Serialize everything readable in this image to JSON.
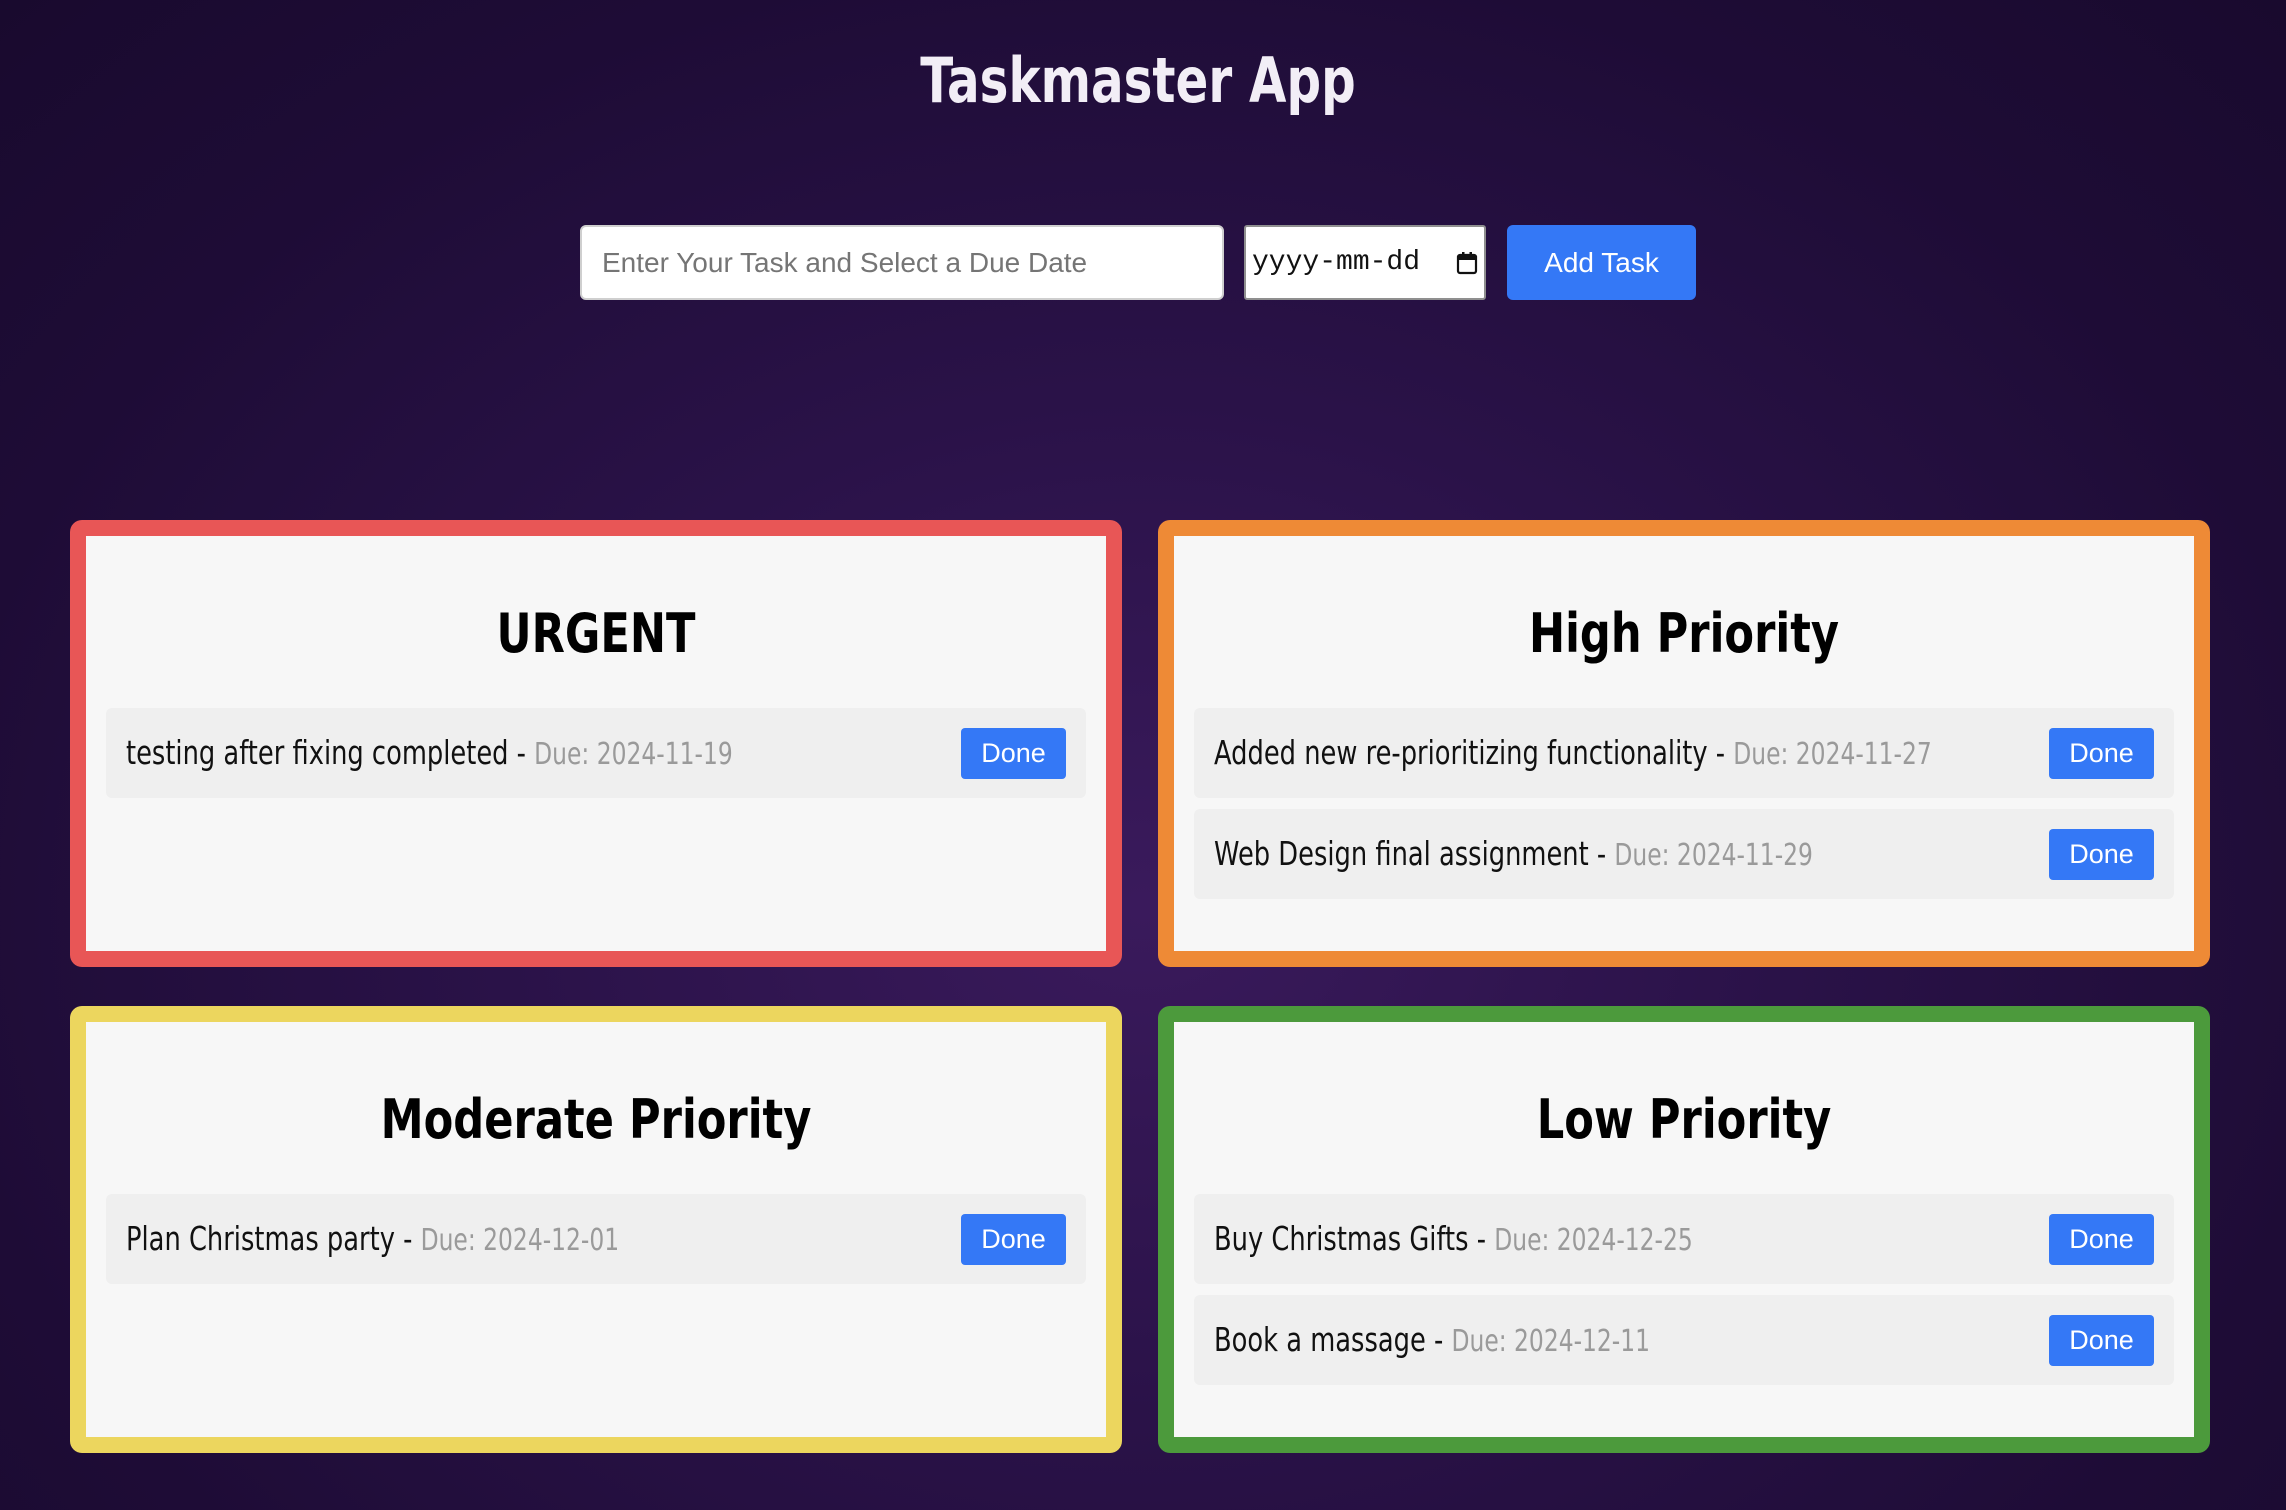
{
  "app": {
    "title": "Taskmaster App"
  },
  "form": {
    "task_placeholder": "Enter Your Task and Select a Due Date",
    "task_value": "",
    "date_placeholder": "yyyy-mm-dd",
    "date_icon": "calendar-icon",
    "add_label": "Add Task",
    "add_color": "#3478f6"
  },
  "panels": {
    "urgent": {
      "title": "URGENT",
      "color": "#e85656",
      "tasks": [
        {
          "name": "testing after fixing completed",
          "separator": " - ",
          "due": "Due: 2024-11-19",
          "action": "Done"
        }
      ]
    },
    "high": {
      "title": "High Priority",
      "color": "#ee8a36",
      "tasks": [
        {
          "name": "Added new re-prioritizing functionality",
          "separator": " - ",
          "due": "Due: 2024-11-27",
          "action": "Done"
        },
        {
          "name": "Web Design final assignment",
          "separator": " - ",
          "due": "Due: 2024-11-29",
          "action": "Done"
        }
      ]
    },
    "moderate": {
      "title": "Moderate Priority",
      "color": "#ecd65e",
      "tasks": [
        {
          "name": "Plan Christmas party",
          "separator": " - ",
          "due": "Due: 2024-12-01",
          "action": "Done"
        }
      ]
    },
    "low": {
      "title": "Low Priority",
      "color": "#4c9a3c",
      "tasks": [
        {
          "name": "Buy Christmas Gifts",
          "separator": " - ",
          "due": "Due: 2024-12-25",
          "action": "Done"
        },
        {
          "name": "Book a massage",
          "separator": " - ",
          "due": "Due: 2024-12-11",
          "action": "Done"
        }
      ]
    }
  }
}
